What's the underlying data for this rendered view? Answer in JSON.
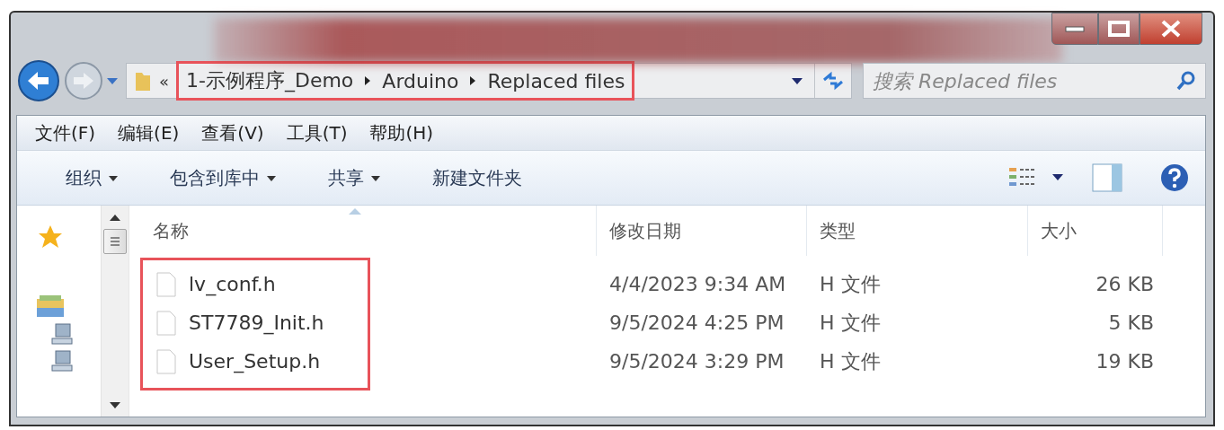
{
  "address": {
    "overflow": "«",
    "segments": [
      "1-示例程序_Demo",
      "Arduino",
      "Replaced files"
    ],
    "highlighted": true
  },
  "search": {
    "placeholder": "搜索 Replaced files"
  },
  "menu": [
    "文件(F)",
    "编辑(E)",
    "查看(V)",
    "工具(T)",
    "帮助(H)"
  ],
  "toolbar": [
    {
      "label": "组织",
      "dropdown": true
    },
    {
      "label": "包含到库中",
      "dropdown": true
    },
    {
      "label": "共享",
      "dropdown": true
    },
    {
      "label": "新建文件夹",
      "dropdown": false
    }
  ],
  "nav_pane": [
    {
      "kind": "star"
    },
    {
      "kind": "library"
    },
    {
      "kind": "computer"
    },
    {
      "kind": "computer"
    }
  ],
  "columns": [
    {
      "label": "名称",
      "sorted": true
    },
    {
      "label": "修改日期",
      "sorted": false
    },
    {
      "label": "类型",
      "sorted": false
    },
    {
      "label": "大小",
      "sorted": false
    }
  ],
  "files": {
    "highlighted": true,
    "rows": [
      {
        "name": "lv_conf.h",
        "date": "4/4/2023 9:34 AM",
        "type": "H 文件",
        "size": "26 KB"
      },
      {
        "name": "ST7789_Init.h",
        "date": "9/5/2024 4:25 PM",
        "type": "H 文件",
        "size": "5 KB"
      },
      {
        "name": "User_Setup.h",
        "date": "9/5/2024 3:29 PM",
        "type": "H 文件",
        "size": "19 KB"
      }
    ]
  }
}
